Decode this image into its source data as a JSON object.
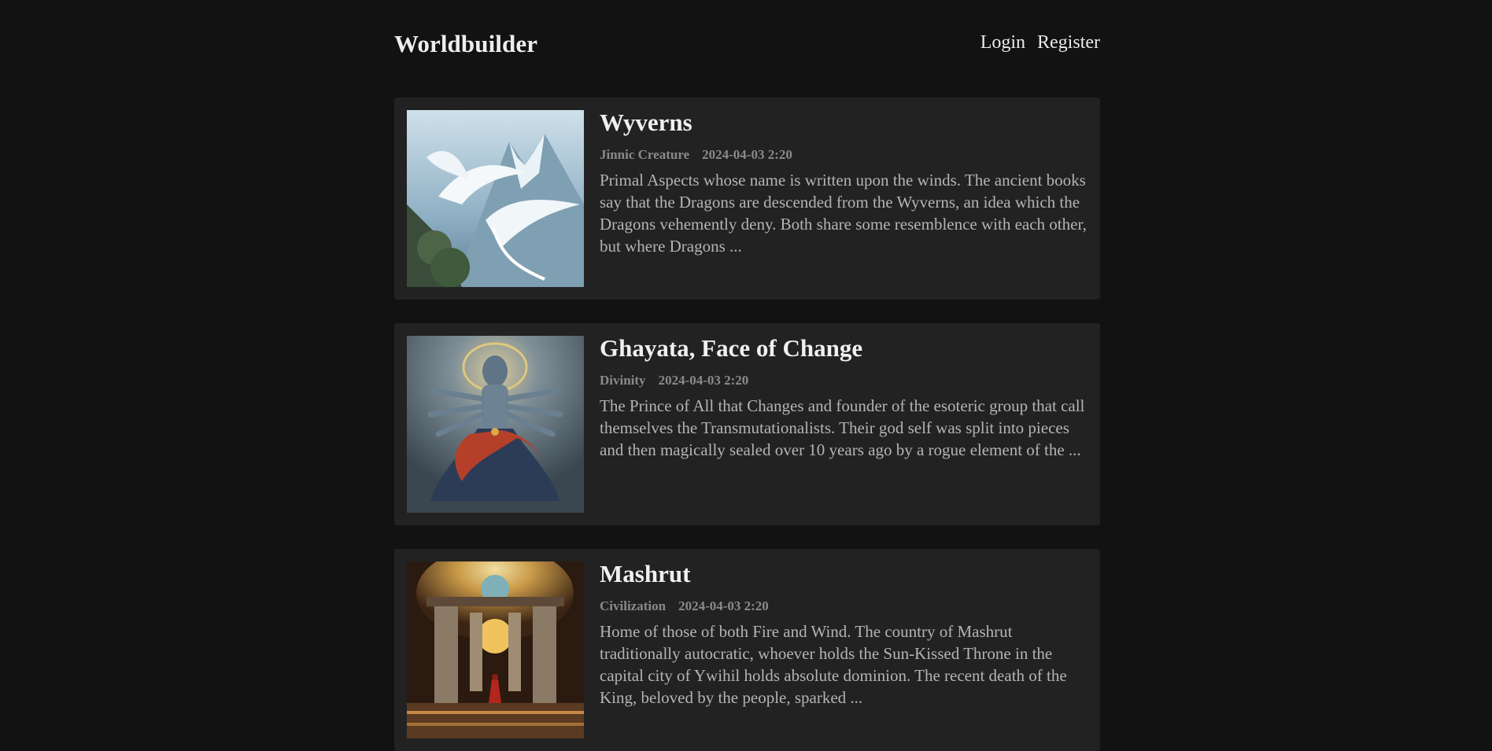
{
  "header": {
    "brand": "Worldbuilder",
    "nav": {
      "login": "Login",
      "register": "Register"
    }
  },
  "articles": [
    {
      "title": "Wyverns",
      "category": "Jinnic Creature",
      "date": "2024-04-03 2:20",
      "excerpt": "Primal Aspects whose name is written upon the winds. The ancient books say that the Dragons are descended from the Wyverns, an idea which the Dragons vehemently deny. Both share some resemblence with each other, but where Dragons ..."
    },
    {
      "title": "Ghayata, Face of Change",
      "category": "Divinity",
      "date": "2024-04-03 2:20",
      "excerpt": "The Prince of All that Changes and founder of the esoteric group that call themselves the Transmutationalists. Their god self was split into pieces and then magically sealed over 10 years ago by a rogue element of the ..."
    },
    {
      "title": "Mashrut",
      "category": "Civilization",
      "date": "2024-04-03 2:20",
      "excerpt": "Home of those of both Fire and Wind. The country of Mashrut traditionally autocratic, whoever holds the Sun-Kissed Throne in the capital city of Ywihil holds absolute dominion. The recent death of the King, beloved by the people, sparked ..."
    }
  ]
}
